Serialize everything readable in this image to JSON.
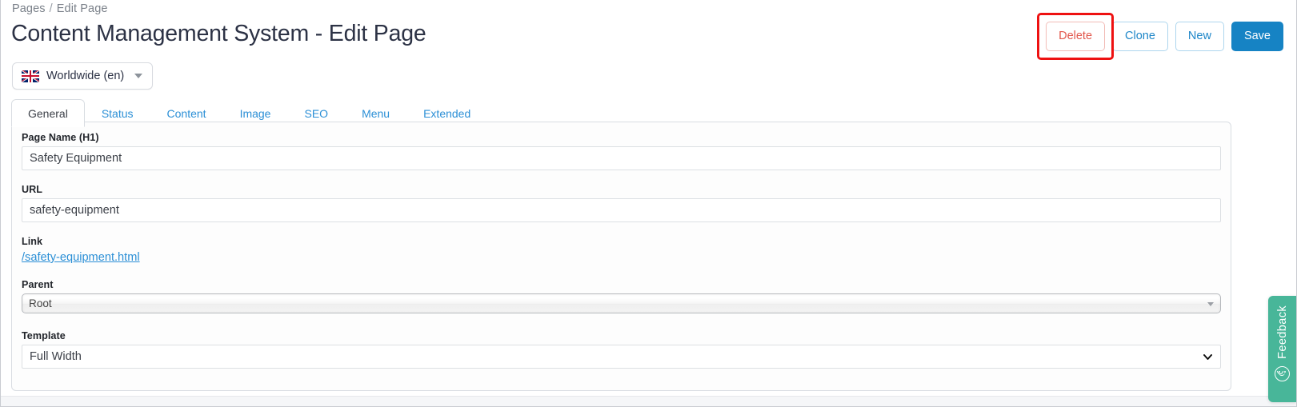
{
  "breadcrumb": {
    "items": [
      "Pages",
      "Edit Page"
    ],
    "separator": "/"
  },
  "header": {
    "title": "Content Management System - Edit Page"
  },
  "toolbar": {
    "delete_label": "Delete",
    "clone_label": "Clone",
    "new_label": "New",
    "save_label": "Save",
    "delete_highlight_color": "#ee1111",
    "primary_color": "#1683c4",
    "danger_color": "#e2574c",
    "link_color": "#2b8fd6"
  },
  "language_selector": {
    "label": "Worldwide (en)",
    "flag": "uk-flag-icon",
    "caret": "chevron-down-icon"
  },
  "tabs": [
    {
      "label": "General",
      "active": true
    },
    {
      "label": "Status",
      "active": false
    },
    {
      "label": "Content",
      "active": false
    },
    {
      "label": "Image",
      "active": false
    },
    {
      "label": "SEO",
      "active": false
    },
    {
      "label": "Menu",
      "active": false
    },
    {
      "label": "Extended",
      "active": false
    }
  ],
  "form": {
    "page_name": {
      "label": "Page Name (H1)",
      "value": "Safety Equipment",
      "placeholder": ""
    },
    "url": {
      "label": "URL",
      "value": "safety-equipment",
      "placeholder": ""
    },
    "link": {
      "label": "Link",
      "value": "/safety-equipment.html"
    },
    "parent": {
      "label": "Parent",
      "value": "Root"
    },
    "template": {
      "label": "Template",
      "value": "Full Width"
    }
  },
  "feedback": {
    "label": "Feedback",
    "icon": "smiley-face-icon",
    "color": "#48b699"
  }
}
